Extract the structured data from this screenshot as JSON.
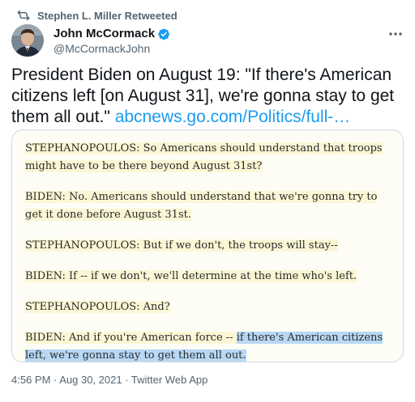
{
  "retweet": {
    "label": "Stephen L. Miller Retweeted"
  },
  "author": {
    "name": "John McCormack",
    "handle": "@McCormackJohn"
  },
  "tweet": {
    "text": "President Biden on August 19: \"If there's American citizens left [on August 31], we're gonna stay to get them all out.\" ",
    "link": "abcnews.go.com/Politics/full-…"
  },
  "transcript": {
    "p1": "STEPHANOPOULOS: So Americans should understand that troops might have to be there beyond August 31st?",
    "p2": "BIDEN: No. Americans should understand that we're gonna try to get it done before August 31st.",
    "p3": "STEPHANOPOULOS: But if we don't, the troops will stay--",
    "p4": "BIDEN: If -- if we don't, we'll determine at the time who's left.",
    "p5": "STEPHANOPOULOS: And?",
    "p6_a": "BIDEN: And if you're American force -- ",
    "p6_b": "if there's American citizens left, we're gonna stay to get them all out."
  },
  "meta": {
    "timestamp": "4:56 PM · Aug 30, 2021 · Twitter Web App"
  },
  "colors": {
    "link": "#1d9bf0",
    "highlight_yellow": "#fbf7d6",
    "highlight_blue": "#b8d8f5"
  },
  "icons": {
    "retweet": "retweet-icon",
    "verified": "verified-badge-icon",
    "more": "more-icon"
  }
}
